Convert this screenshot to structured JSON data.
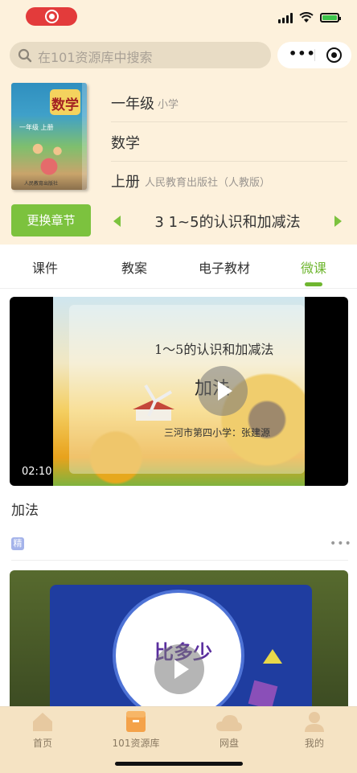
{
  "search": {
    "placeholder": "在101资源库中搜索"
  },
  "book": {
    "cover_title": "数学",
    "cover_sub": "一年级 上册",
    "cover_pub": "人民教育出版社",
    "grade": "一年级",
    "level": "小学",
    "subject": "数学",
    "volume": "上册",
    "publisher": "人民教育出版社（人教版）"
  },
  "chapter": {
    "button_label": "更换章节",
    "title": "3 1~5的认识和加减法"
  },
  "tabs": [
    {
      "label": "课件"
    },
    {
      "label": "教案"
    },
    {
      "label": "电子教材"
    },
    {
      "label": "微课"
    }
  ],
  "active_tab": "微课",
  "videos": [
    {
      "frame_title": "1～5的认识和加减法",
      "frame_heading": "加法",
      "frame_author": "三河市第四小学：张建源",
      "duration": "02:10",
      "title": "加法",
      "badge": "精"
    },
    {
      "frame_heading": "比多少"
    }
  ],
  "tabbar": [
    {
      "label": "首页",
      "icon": "home-icon"
    },
    {
      "label": "101资源库",
      "icon": "library-icon"
    },
    {
      "label": "网盘",
      "icon": "cloud-icon"
    },
    {
      "label": "我的",
      "icon": "user-icon"
    }
  ],
  "colors": {
    "accent": "#7cc23e",
    "record": "#e33b3b",
    "background": "#fdf1dc"
  }
}
